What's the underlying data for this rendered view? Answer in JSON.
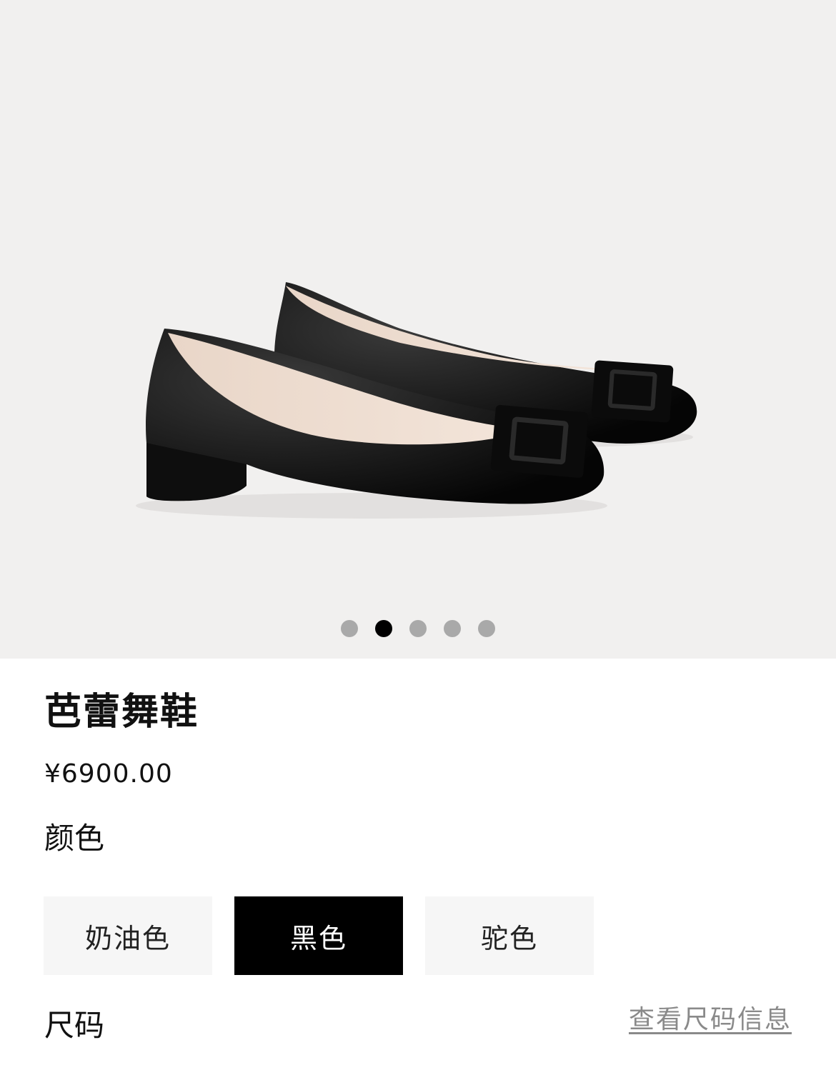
{
  "gallery": {
    "image_alt": "black patent leather ballet flats with square buckle",
    "current_index": 2,
    "total": 5,
    "dot_active_color": "#000000",
    "dot_inactive_color": "#a9a9a9"
  },
  "product": {
    "title": "芭蕾舞鞋",
    "price": "¥6900.00"
  },
  "color": {
    "label": "颜色",
    "options": [
      {
        "label": "奶油色",
        "selected": false
      },
      {
        "label": "黑色",
        "selected": true
      },
      {
        "label": "驼色",
        "selected": false
      }
    ]
  },
  "size": {
    "label": "尺码",
    "guide_link": "查看尺码信息"
  }
}
